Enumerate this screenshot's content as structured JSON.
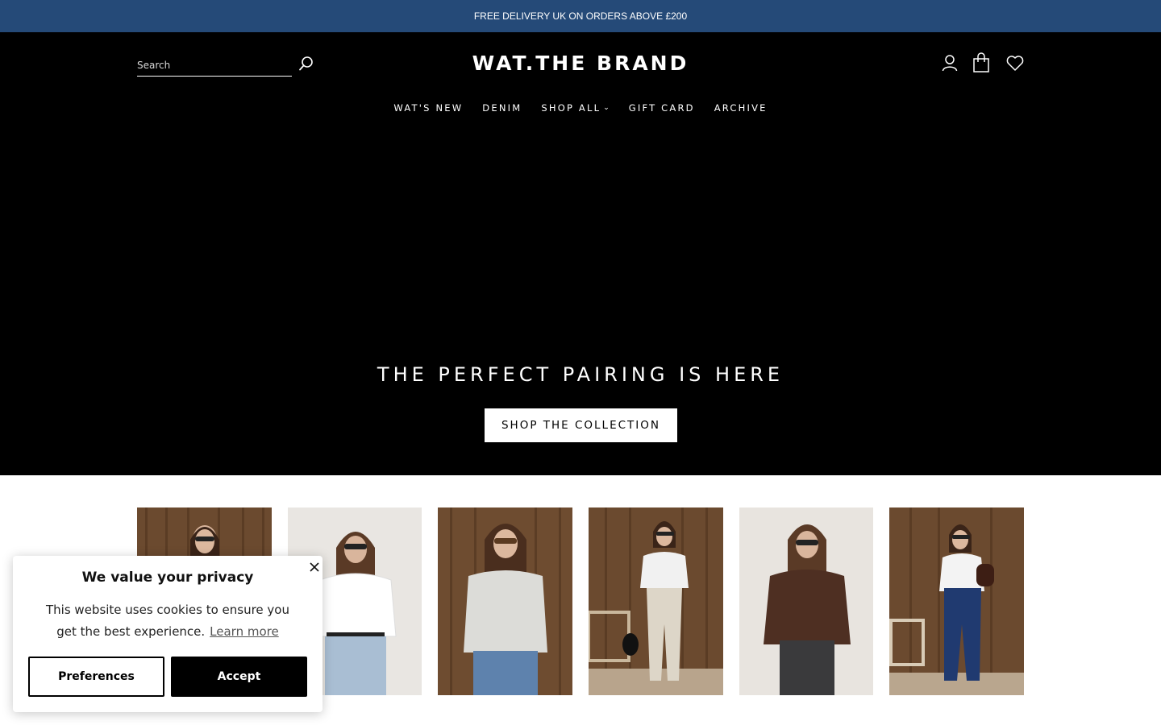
{
  "announcement": {
    "text": "FREE DELIVERY UK ON ORDERS ABOVE £200"
  },
  "header": {
    "logo": "WAT.THE BRAND",
    "search_placeholder": "Search",
    "nav": [
      {
        "label": "WAT'S NEW"
      },
      {
        "label": "DENIM"
      },
      {
        "label": "SHOP ALL",
        "has_dropdown": true
      },
      {
        "label": "GIFT CARD"
      },
      {
        "label": "ARCHIVE"
      }
    ],
    "icons": [
      "search-icon",
      "account-icon",
      "shopping-bag-icon",
      "wishlist-heart-icon",
      "chevron-down-icon"
    ]
  },
  "hero": {
    "title": "THE PERFECT PAIRING IS HERE",
    "button_label": "SHOP THE COLLECTION",
    "background": "#000000"
  },
  "gallery": {
    "tiles": [
      {
        "top": "white t-shirt",
        "backdrop": "wood"
      },
      {
        "top": "white t-shirt",
        "backdrop": "grey"
      },
      {
        "top": "grey t-shirt",
        "backdrop": "wood"
      },
      {
        "top": "white cropped t-shirt",
        "backdrop": "wood"
      },
      {
        "top": "brown t-shirt",
        "backdrop": "grey"
      },
      {
        "top": "white t-shirt",
        "backdrop": "wood"
      }
    ]
  },
  "cookie_banner": {
    "title": "We value your privacy",
    "text": "This website uses cookies to ensure you get the best experience.",
    "link_label": "Learn more",
    "preferences_label": "Preferences",
    "accept_label": "Accept"
  },
  "colors": {
    "announcement_bg": "#254a78",
    "header_bg": "#000000",
    "wood": "#6b4a2f",
    "grey_wall": "#e9e6e2"
  }
}
